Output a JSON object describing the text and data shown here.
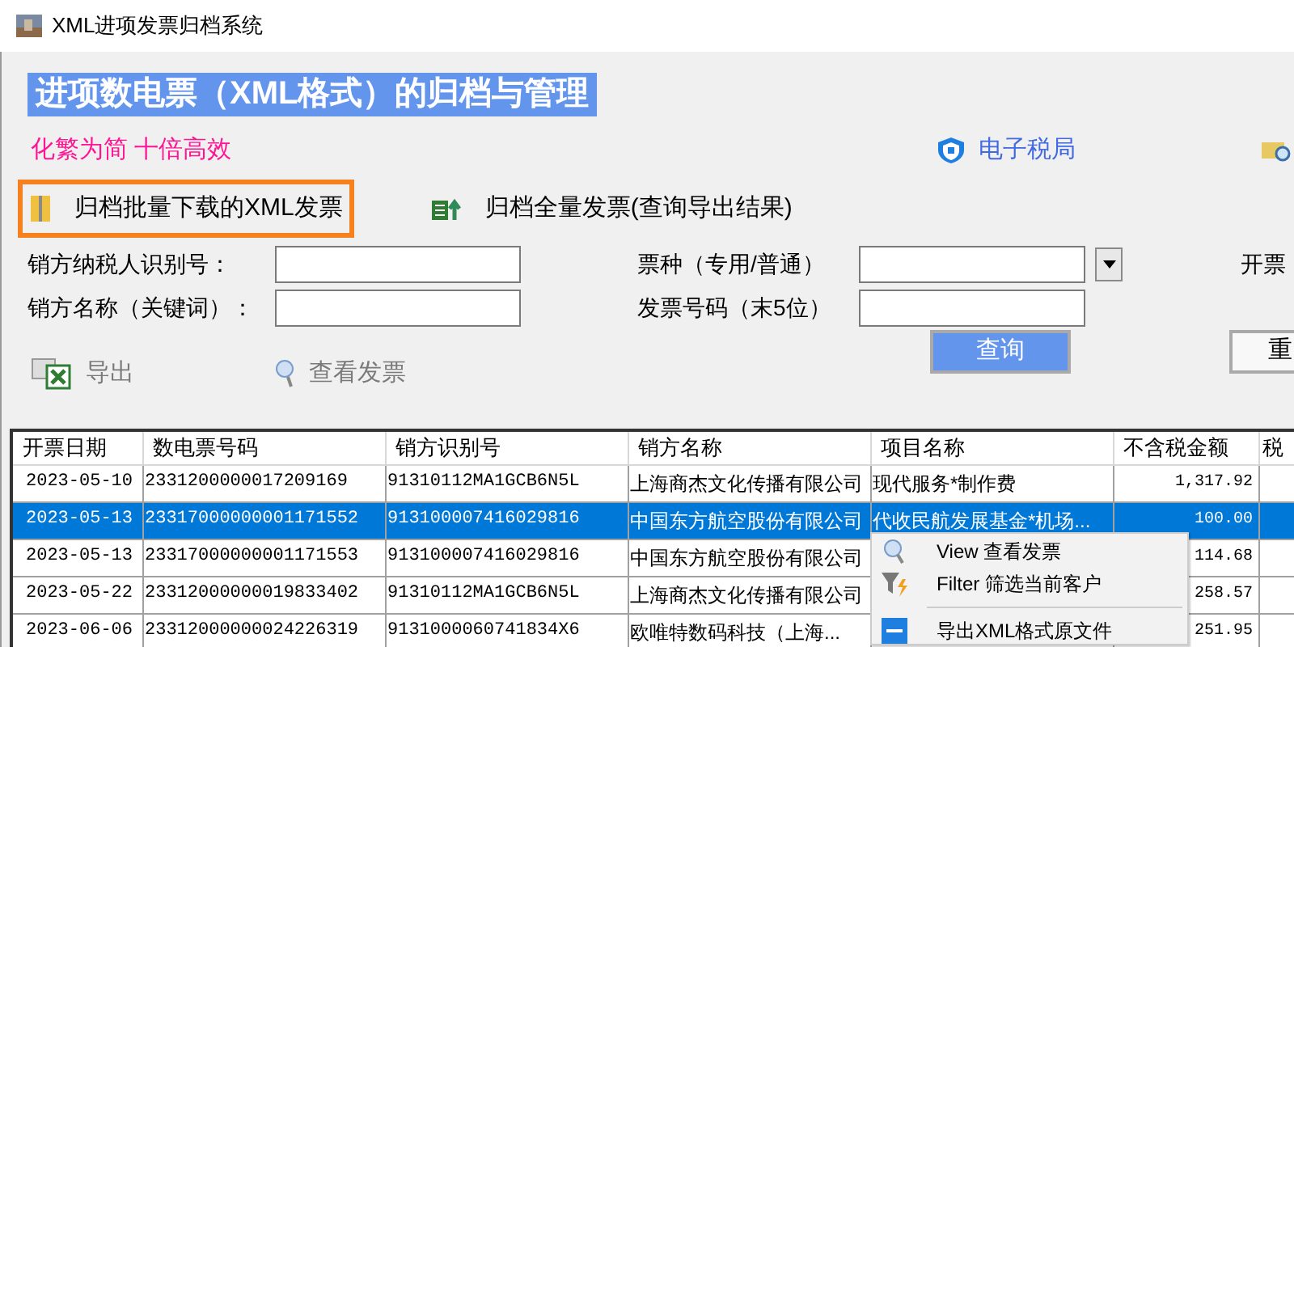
{
  "window": {
    "title": "XML进项发票归档系统"
  },
  "banner": {
    "title": "进项数电票（XML格式）的归档与管理",
    "slogan": "化繁为简 十倍高效",
    "link": "电子税局"
  },
  "actions": [
    {
      "label": "归档批量下载的XML发票",
      "selected": true,
      "kind": "archive"
    },
    {
      "label": "归档全量发票(查询导出结果)",
      "selected": false,
      "kind": "sheet"
    }
  ],
  "filters": [
    {
      "label": "销方纳税人识别号：",
      "kind": "text"
    },
    {
      "label": "票种（专用/普通）",
      "kind": "dropdown"
    },
    {
      "label": "开票",
      "kind": "cut"
    },
    {
      "label": "销方名称（关键词）：",
      "kind": "text"
    },
    {
      "label": "发票号码（末5位）",
      "kind": "text"
    }
  ],
  "toolbar": [
    {
      "label": "导出",
      "kind": "export"
    },
    {
      "label": "查看发票",
      "kind": "view"
    }
  ],
  "buttons": {
    "query": "查询",
    "reset": "重"
  },
  "table": {
    "columns": [
      "开票日期",
      "数电票号码",
      "销方识别号",
      "销方名称",
      "项目名称",
      "不含税金额",
      "税"
    ],
    "rows": [
      {
        "date": "2023-05-10",
        "number": "2331200000017209169",
        "seller_id": "91310112MA1GCB6N5L",
        "seller": "上海商杰文化传播有限公司",
        "item": "现代服务*制作费",
        "amount": "1,317.92",
        "selected": false
      },
      {
        "date": "2023-05-13",
        "number": "23317000000001171552",
        "seller_id": "913100007416029816",
        "seller": "中国东方航空股份有限公司",
        "item": "代收民航发展基金*机场...",
        "amount": "100.00",
        "selected": true
      },
      {
        "date": "2023-05-13",
        "number": "23317000000001171553",
        "seller_id": "913100007416029816",
        "seller": "中国东方航空股份有限公司",
        "amount": "114.68",
        "selected": false
      },
      {
        "date": "2023-05-22",
        "number": "23312000000019833402",
        "seller_id": "91310112MA1GCB6N5L",
        "seller": "上海商杰文化传播有限公司",
        "amount": "258.57",
        "selected": false
      },
      {
        "date": "2023-06-06",
        "number": "23312000000024226319",
        "seller_id": "9131000060741834X6",
        "seller": "欧唯特数码科技（上海...",
        "amount": "251.95",
        "selected": false
      }
    ]
  },
  "context_menu": [
    {
      "label": "View 查看发票",
      "kind": "view"
    },
    {
      "label": "Filter 筛选当前客户",
      "kind": "filter"
    },
    {
      "kind": "separator"
    },
    {
      "label": "导出XML格式原文件",
      "kind": "xml"
    }
  ]
}
